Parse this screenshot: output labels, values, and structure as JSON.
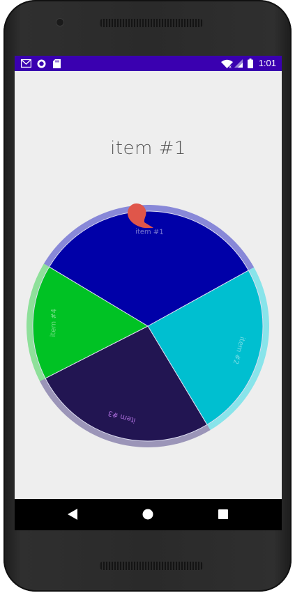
{
  "app": {
    "title": "item #1"
  },
  "status_bar": {
    "time": "1:01",
    "left_icons": [
      "gmail-icon",
      "sync-icon",
      "sd-card-icon"
    ],
    "right_icons": [
      "wifi-icon",
      "cell-signal-icon",
      "battery-icon"
    ]
  },
  "wheel": {
    "segments": [
      {
        "label": "item #1",
        "color": "#0000a8",
        "ring": "#8888d8"
      },
      {
        "label": "item #2",
        "color": "#00bfd0",
        "ring": "#88e4ea"
      },
      {
        "label": "item #3",
        "color": "#221552",
        "ring": "#9b95b8"
      },
      {
        "label": "item #4",
        "color": "#00c224",
        "ring": "#8ee09a"
      }
    ],
    "pointer_color": "#e0564a"
  },
  "nav_bar": {
    "buttons": [
      "back-button",
      "home-button",
      "recents-button"
    ]
  }
}
